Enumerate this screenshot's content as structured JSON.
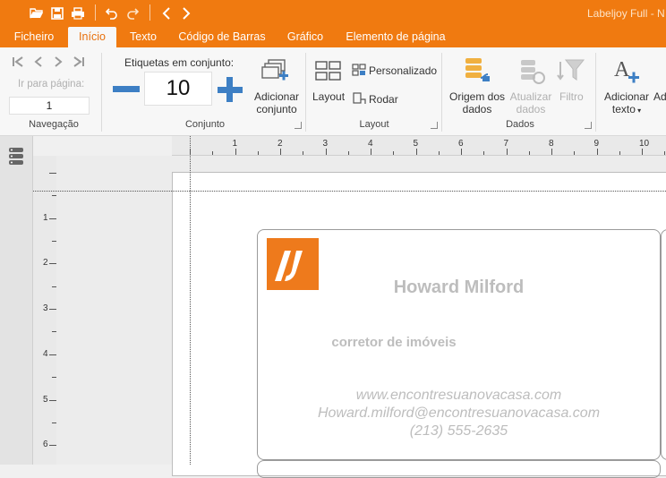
{
  "app": {
    "title": "Labeljoy Full - N"
  },
  "quick_access": {
    "open_icon": "folder-open-icon",
    "save_icon": "floppy-icon",
    "print_icon": "printer-icon",
    "undo_icon": "undo-icon",
    "redo_icon": "redo-icon",
    "back_icon": "chevron-left-icon",
    "forward_icon": "chevron-right-icon"
  },
  "tabs": [
    {
      "label": "Ficheiro"
    },
    {
      "label": "Início"
    },
    {
      "label": "Texto"
    },
    {
      "label": "Código de Barras"
    },
    {
      "label": "Gráfico"
    },
    {
      "label": "Elemento de página"
    }
  ],
  "ribbon": {
    "navigation": {
      "goto_label": "Ir para página:",
      "page_value": "1",
      "group_label": "Navegação"
    },
    "set": {
      "labels_in_set": "Etiquetas em conjunto:",
      "quantity": "10",
      "add_set_label_1": "Adicionar",
      "add_set_label_2": "conjunto",
      "group_label": "Conjunto"
    },
    "layout": {
      "layout_label": "Layout",
      "custom_label": "Personalizado",
      "rotate_label": "Rodar",
      "group_label": "Layout"
    },
    "data": {
      "source_label_1": "Origem dos",
      "source_label_2": "dados",
      "update_label_1": "Atualizar",
      "update_label_2": "dados",
      "filter_label": "Filtro",
      "group_label": "Dados"
    },
    "text": {
      "add_text_label_1": "Adicionar",
      "add_text_label_2": "texto",
      "add_more": "Ad"
    }
  },
  "ruler": {
    "h_numbers": [
      "1",
      "2",
      "3",
      "4",
      "5",
      "6",
      "7",
      "8",
      "9",
      "10"
    ],
    "v_numbers": [
      "1",
      "2",
      "3",
      "4",
      "5",
      "6"
    ]
  },
  "label": {
    "name": "Howard Milford",
    "role": "corretor de imóveis",
    "website": "www.encontresuanovacasa.com",
    "email": "Howard.milford@encontresuanovacasa.com",
    "phone": "(213) 555-2635"
  }
}
